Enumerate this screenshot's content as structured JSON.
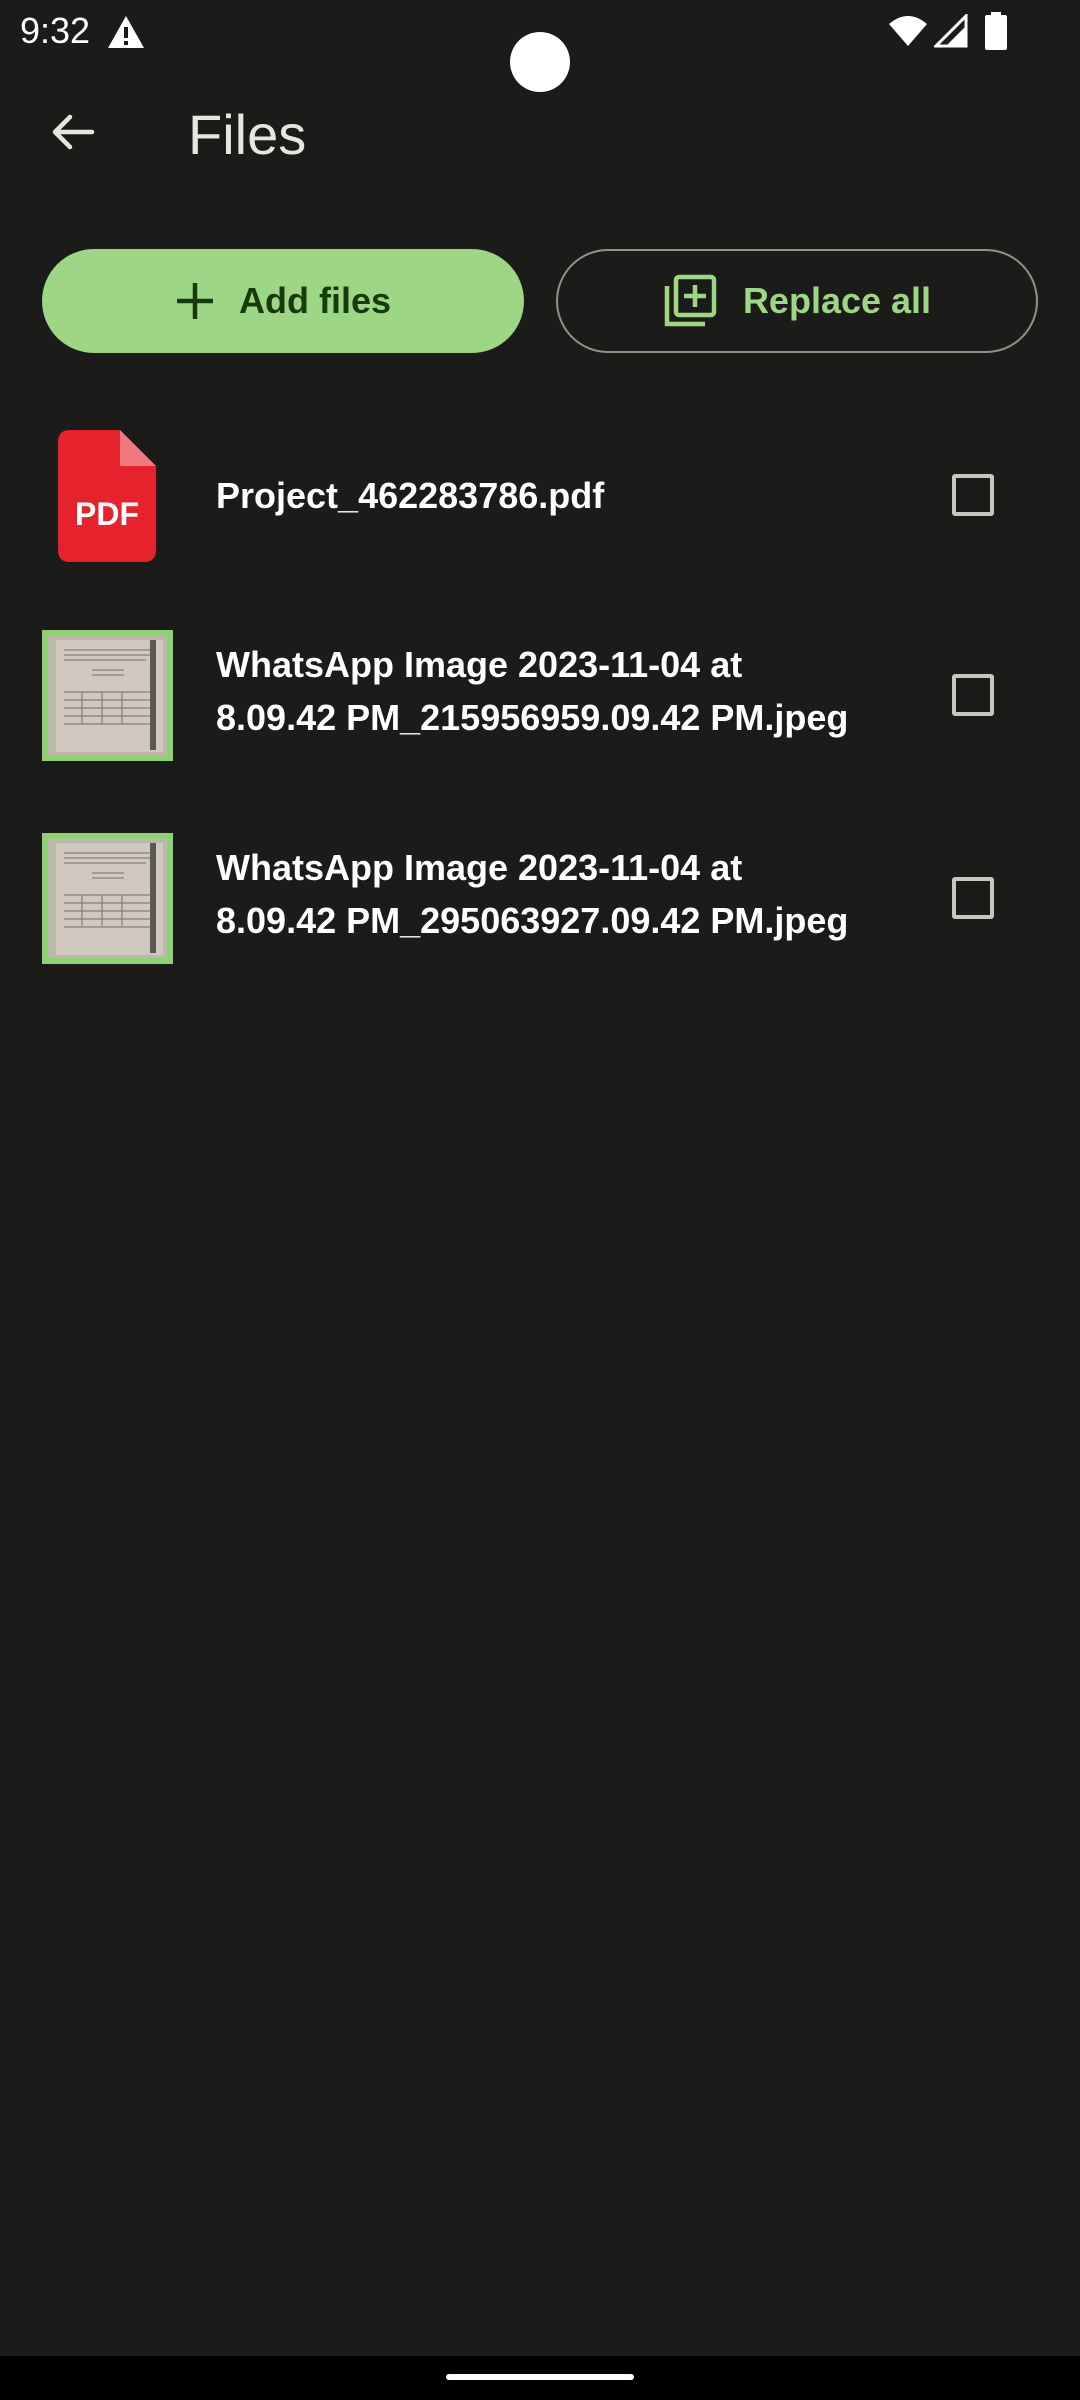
{
  "status_bar": {
    "time": "9:32",
    "icons": [
      "warning-icon",
      "wifi-icon",
      "signal-icon",
      "battery-icon"
    ]
  },
  "app_bar": {
    "title": "Files",
    "back_icon": "arrow-back-icon"
  },
  "actions": {
    "add_files_label": "Add files",
    "add_files_icon": "plus-icon",
    "replace_all_label": "Replace all",
    "replace_all_icon": "library-add-icon"
  },
  "files": [
    {
      "name": "Project_462283786.pdf",
      "type": "pdf",
      "icon_label": "PDF",
      "checked": false
    },
    {
      "name": "WhatsApp Image 2023-11-04 at\n8.09.42 PM_215956959.09.42 PM.jpeg",
      "type": "image",
      "checked": false
    },
    {
      "name": "WhatsApp Image 2023-11-04 at\n8.09.42 PM_295063927.09.42 PM.jpeg",
      "type": "image",
      "checked": false
    }
  ],
  "colors": {
    "background": "#1b1c19",
    "accent": "#9dd685",
    "on_accent": "#173b0c",
    "pdf_red": "#e5232c"
  }
}
